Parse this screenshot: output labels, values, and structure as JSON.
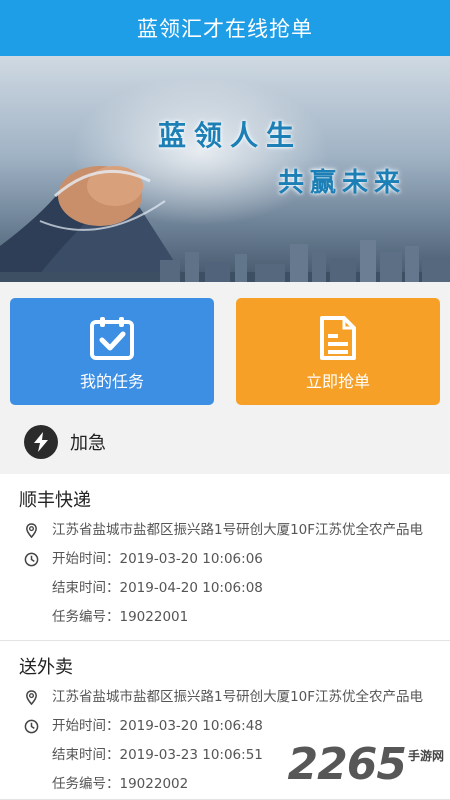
{
  "header": {
    "title": "蓝领汇才在线抢单"
  },
  "banner": {
    "slogan_line1": "蓝领人生",
    "slogan_line2": "共赢未来"
  },
  "actions": {
    "my_tasks_label": "我的任务",
    "grab_now_label": "立即抢单",
    "colors": {
      "my_tasks": "#3d8fe3",
      "grab_now": "#f6a028"
    }
  },
  "urgent": {
    "label": "加急"
  },
  "tasks": [
    {
      "title": "顺丰快递",
      "address": "江苏省盐城市盐都区振兴路1号研创大厦10F江苏优全农产品电",
      "start_time": "开始时间：2019-03-20 10:06:06",
      "end_time": "结束时间：2019-04-20 10:06:08",
      "task_no": "任务编号：19022001"
    },
    {
      "title": "送外卖",
      "address": "江苏省盐城市盐都区振兴路1号研创大厦10F江苏优全农产品电",
      "start_time": "开始时间：2019-03-20 10:06:48",
      "end_time": "结束时间：2019-03-23 10:06:51",
      "task_no": "任务编号：19022002"
    }
  ],
  "watermark": {
    "number": "2265",
    "suffix": "手游网"
  },
  "theme": {
    "primary": "#1e9ee6"
  }
}
